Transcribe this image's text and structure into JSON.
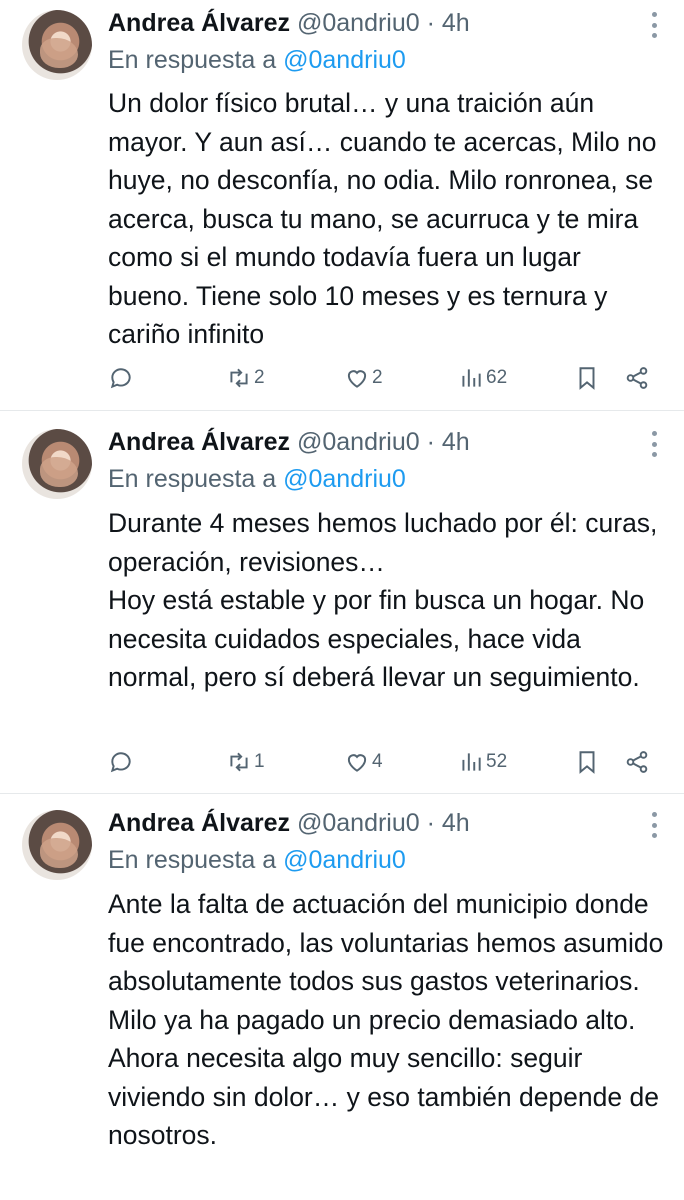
{
  "tweets": [
    {
      "name": "Andrea Álvarez",
      "handle": "@0andriu0",
      "separator": "·",
      "time": "4h",
      "reply_prefix": "En respuesta a",
      "reply_mention": "@0andriu0",
      "text": "Un dolor físico brutal… y una traición aún mayor. Y aun así… cuando te acercas, Milo no huye, no desconfía, no odia. Milo ronronea, se acerca, busca tu mano, se acurruca y te mira como si el mundo todavía fuera un lugar bueno. Tiene solo 10 meses y es ternura y cariño infinito",
      "retweets": "2",
      "likes": "2",
      "views": "62"
    },
    {
      "name": "Andrea Álvarez",
      "handle": "@0andriu0",
      "separator": "·",
      "time": "4h",
      "reply_prefix": "En respuesta a",
      "reply_mention": "@0andriu0",
      "text_lines": [
        "Durante 4 meses hemos luchado por él: curas, operación, revisiones…",
        "Hoy está estable y por fin busca un hogar. No necesita cuidados especiales, hace vida normal, pero sí deberá llevar un seguimiento."
      ],
      "retweets": "1",
      "likes": "4",
      "views": "52"
    },
    {
      "name": "Andrea Álvarez",
      "handle": "@0andriu0",
      "separator": "·",
      "time": "4h",
      "reply_prefix": "En respuesta a",
      "reply_mention": "@0andriu0",
      "text_lines": [
        "Ante la falta de actuación del municipio donde fue encontrado, las voluntarias hemos asumido absolutamente todos sus gastos veterinarios.",
        "Milo ya ha pagado un precio demasiado alto. Ahora necesita algo muy sencillo: seguir viviendo sin dolor… y eso también depende de nosotros."
      ]
    }
  ],
  "icons": {
    "reply": "speech-bubble-icon",
    "retweet": "retweet-icon",
    "like": "heart-icon",
    "views": "bar-chart-icon",
    "bookmark": "bookmark-icon",
    "share": "share-icon",
    "more": "vertical-dots-icon"
  },
  "colors": {
    "text": "#0f1419",
    "muted": "#536471",
    "link": "#1d9bf0",
    "divider": "#e6e9eb"
  }
}
